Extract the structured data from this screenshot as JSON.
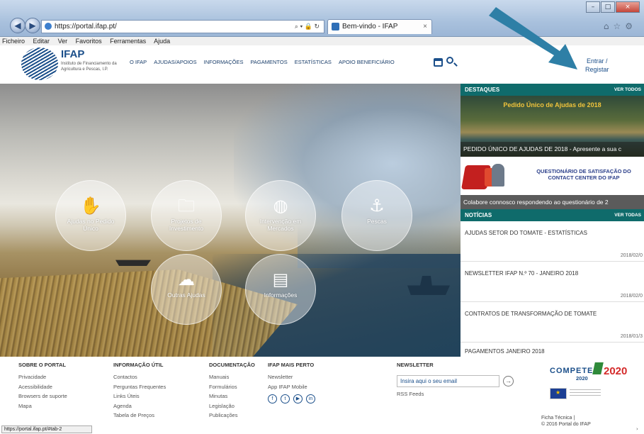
{
  "browser": {
    "url": "https://portal.ifap.pt/",
    "tab_title": "Bem-vindo - IFAP",
    "menu": [
      "Ficheiro",
      "Editar",
      "Ver",
      "Favoritos",
      "Ferramentas",
      "Ajuda"
    ],
    "status_url": "https://portal.ifap.pt/#tab-2",
    "accent": "#2e7fa6"
  },
  "header": {
    "logo_title": "IFAP",
    "logo_subtitle": "Instituto de Financiamento da Agricultura e Pescas, I.P.",
    "nav": [
      "O IFAP",
      "AJUDAS/APOIOS",
      "INFORMAÇÕES",
      "PAGAMENTOS",
      "ESTATÍSTICAS",
      "APOIO BENEFICIÁRIO"
    ],
    "login_line1": "Entrar /",
    "login_line2": "Registar"
  },
  "hero": {
    "tiles": [
      {
        "label": "Ajudas no Pedido Único",
        "icon": "hands-icon"
      },
      {
        "label": "Projetos de Investimento",
        "icon": "folder-icon"
      },
      {
        "label": "Intervenção em Mercados",
        "icon": "globe-icon"
      },
      {
        "label": "Pescas",
        "icon": "fishing-icon"
      },
      {
        "label": "Outras Ajudas",
        "icon": "landscape-icon"
      },
      {
        "label": "Informações",
        "icon": "id-card-icon"
      }
    ]
  },
  "destaques": {
    "heading": "DESTAQUES",
    "more": "VER TODOS",
    "promo1_title": "Pedido Único de Ajudas de 2018",
    "promo1_caption": "PEDIDO ÚNICO DE AJUDAS DE 2018 - Apresente a sua c",
    "promo2_title": "QUESTIONÁRIO DE SATISFAÇÃO DO CONTACT CENTER DO IFAP",
    "promo2_caption": "Colabore connosco respondendo ao questionário de  2"
  },
  "noticias": {
    "heading": "NOTÍCIAS",
    "more": "VER TODAS",
    "items": [
      {
        "title": "AJUDAS SETOR DO TOMATE - ESTATÍSTICAS",
        "date": "2018/02/0"
      },
      {
        "title": "NEWSLETTER IFAP N.º 70 - JANEIRO 2018",
        "date": "2018/02/0"
      },
      {
        "title": "CONTRATOS DE TRANSFORMAÇÃO DE TOMATE",
        "date": "2018/01/3"
      }
    ],
    "last_title": "PAGAMENTOS JANEIRO 2018"
  },
  "footer": {
    "col1": {
      "title": "SOBRE O PORTAL",
      "links": [
        "Privacidade",
        "Acessibilidade",
        "Browsers de suporte",
        "Mapa"
      ]
    },
    "col2": {
      "title": "INFORMAÇÃO ÚTIL",
      "links": [
        "Contactos",
        "Perguntas Frequentes",
        "Links Úteis",
        "Agenda",
        "Tabela de Preços"
      ]
    },
    "col3": {
      "title": "DOCUMENTAÇÃO",
      "links": [
        "Manuais",
        "Formulários",
        "Minutas",
        "Legislação",
        "Publicações"
      ]
    },
    "col4": {
      "title": "IFAP MAIS PERTO",
      "links": [
        "Newsletter",
        "App IFAP Mobile"
      ]
    },
    "newsletter_title": "NEWSLETTER",
    "newsletter_placeholder": "Insira aqui o seu email",
    "rss": "RSS Feeds",
    "compete": "COMPETE",
    "compete_year": "2020",
    "portugal": "2020",
    "copyright_line1": "Ficha Técnica  |",
    "copyright_line2": "© 2016 Portal do IFAP"
  }
}
